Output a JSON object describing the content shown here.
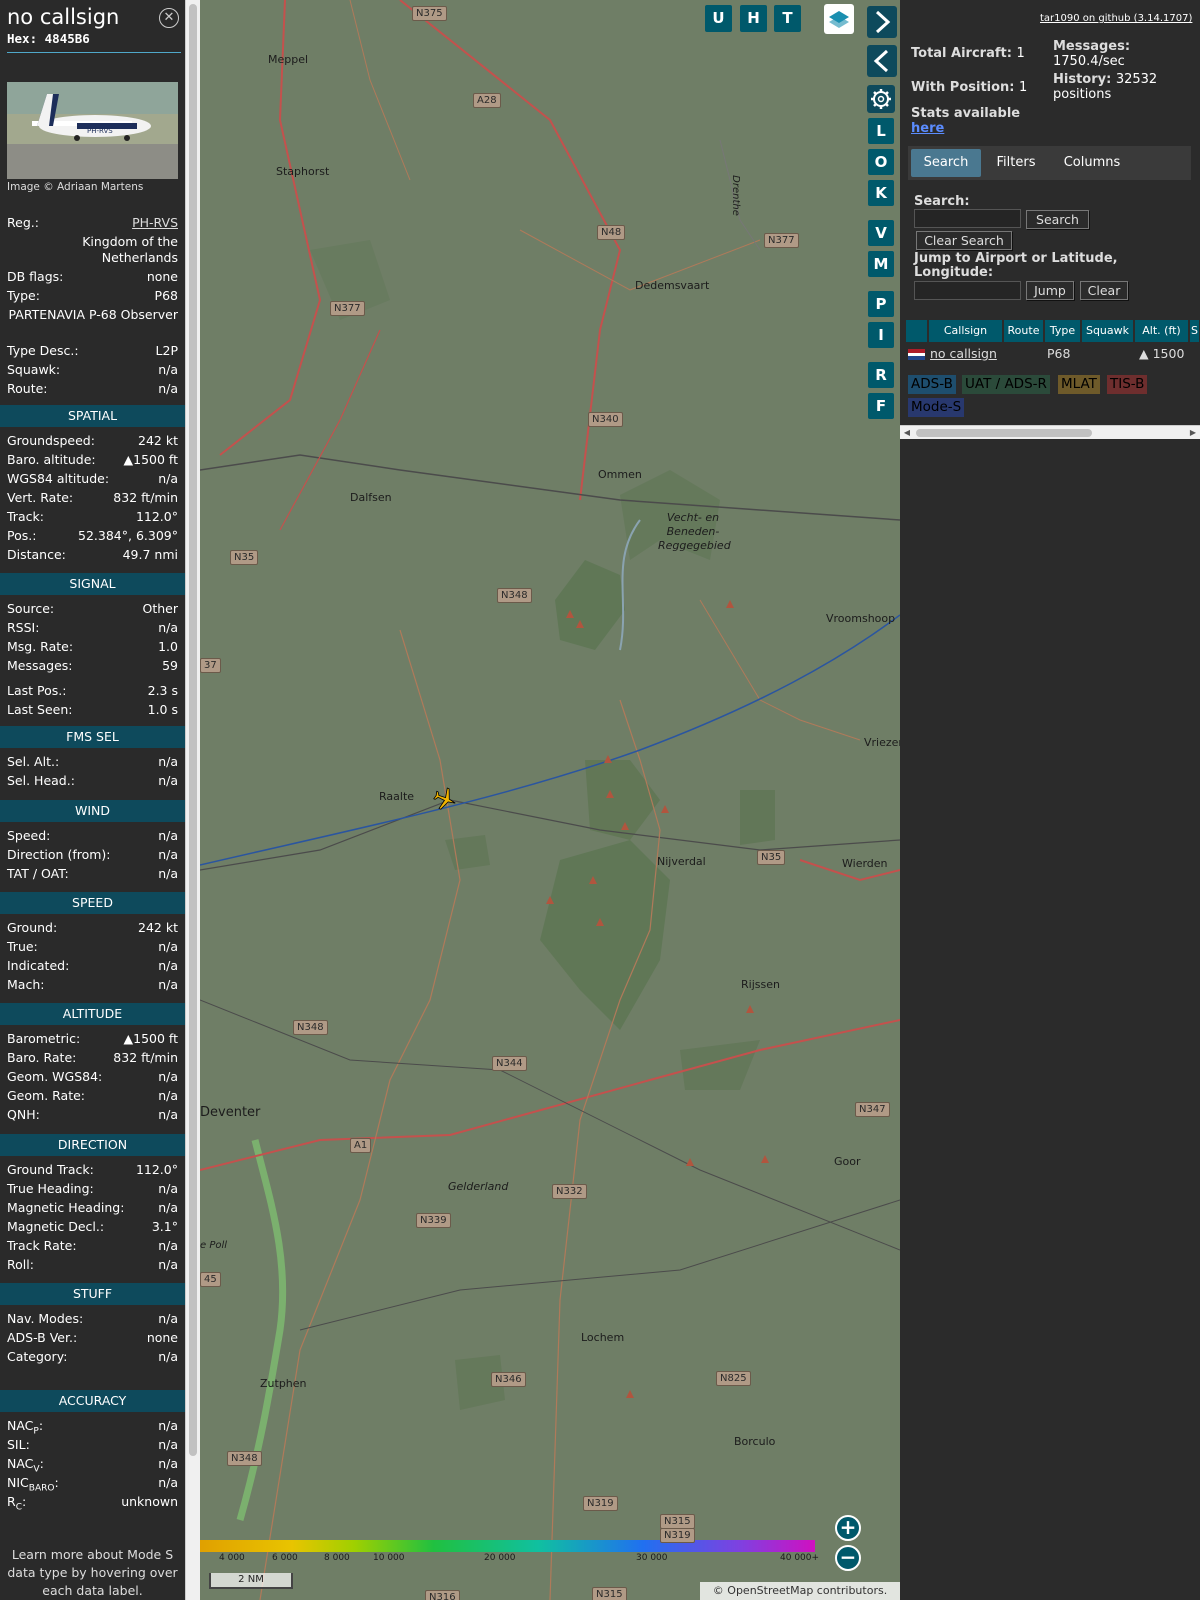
{
  "info": {
    "callsign": "no callsign",
    "hex_label": "Hex:",
    "hex": "4845B6",
    "photo_credit": "Image © Adriaan Martens",
    "photo_reg": "PH-RVS",
    "reg_label": "Reg.:",
    "reg": "PH-RVS",
    "country": "Kingdom of the Netherlands",
    "dbflags_label": "DB flags:",
    "dbflags": "none",
    "type_label": "Type:",
    "type": "P68",
    "type_full": "PARTENAVIA P-68 Observer",
    "typedesc_label": "Type Desc.:",
    "typedesc": "L2P",
    "squawk_label": "Squawk:",
    "squawk": "n/a",
    "route_label": "Route:",
    "route": "n/a",
    "sections": {
      "spatial": "SPATIAL",
      "signal": "SIGNAL",
      "fms": "FMS SEL",
      "wind": "WIND",
      "speed": "SPEED",
      "altitude": "ALTITUDE",
      "direction": "DIRECTION",
      "stuff": "STUFF",
      "accuracy": "ACCURACY"
    },
    "spatial": [
      {
        "k": "Groundspeed:",
        "v": "242 kt"
      },
      {
        "k": "Baro. altitude:",
        "v": "▲1500 ft"
      },
      {
        "k": "WGS84 altitude:",
        "v": "n/a"
      },
      {
        "k": "Vert. Rate:",
        "v": "832 ft/min"
      },
      {
        "k": "Track:",
        "v": "112.0°"
      },
      {
        "k": "Pos.:",
        "v": "52.384°, 6.309°"
      },
      {
        "k": "Distance:",
        "v": "49.7 nmi"
      }
    ],
    "signal": [
      {
        "k": "Source:",
        "v": "Other"
      },
      {
        "k": "RSSI:",
        "v": "n/a"
      },
      {
        "k": "Msg. Rate:",
        "v": "1.0"
      },
      {
        "k": "Messages:",
        "v": "59"
      },
      {
        "k": "Last Pos.:",
        "v": "2.3 s"
      },
      {
        "k": "Last Seen:",
        "v": "1.0 s"
      }
    ],
    "fms": [
      {
        "k": "Sel. Alt.:",
        "v": "n/a"
      },
      {
        "k": "Sel. Head.:",
        "v": "n/a"
      }
    ],
    "wind": [
      {
        "k": "Speed:",
        "v": "n/a"
      },
      {
        "k": "Direction (from):",
        "v": "n/a"
      },
      {
        "k": "TAT / OAT:",
        "v": "n/a"
      }
    ],
    "speed": [
      {
        "k": "Ground:",
        "v": "242 kt"
      },
      {
        "k": "True:",
        "v": "n/a"
      },
      {
        "k": "Indicated:",
        "v": "n/a"
      },
      {
        "k": "Mach:",
        "v": "n/a"
      }
    ],
    "altitude": [
      {
        "k": "Barometric:",
        "v": "▲1500 ft"
      },
      {
        "k": "Baro. Rate:",
        "v": "832 ft/min"
      },
      {
        "k": "Geom. WGS84:",
        "v": "n/a"
      },
      {
        "k": "Geom. Rate:",
        "v": "n/a"
      },
      {
        "k": "QNH:",
        "v": "n/a"
      }
    ],
    "direction": [
      {
        "k": "Ground Track:",
        "v": "112.0°"
      },
      {
        "k": "True Heading:",
        "v": "n/a"
      },
      {
        "k": "Magnetic Heading:",
        "v": "n/a"
      },
      {
        "k": "Magnetic Decl.:",
        "v": "3.1°"
      },
      {
        "k": "Track Rate:",
        "v": "n/a"
      },
      {
        "k": "Roll:",
        "v": "n/a"
      }
    ],
    "stuff": [
      {
        "k": "Nav. Modes:",
        "v": "n/a"
      },
      {
        "k": "ADS-B Ver.:",
        "v": "none"
      },
      {
        "k": "Category:",
        "v": "n/a"
      }
    ],
    "accuracy": [
      {
        "k": "NAC",
        "sub": "P",
        "v": "n/a"
      },
      {
        "k": "SIL:",
        "sub": "",
        "v": "n/a"
      },
      {
        "k": "NAC",
        "sub": "V",
        "v": "n/a"
      },
      {
        "k": "NIC",
        "sub": "BARO",
        "v": "n/a"
      },
      {
        "k": "R",
        "sub": "C",
        "v": "unknown"
      }
    ],
    "learn_more": "Learn more about Mode S data type by hovering over each data label."
  },
  "map": {
    "toolbar_top": [
      "U",
      "H",
      "T"
    ],
    "toolbar_side": [
      "L",
      "O",
      "K",
      "V",
      "M",
      "P",
      "I",
      "R",
      "F"
    ],
    "icons": {
      "layers": "layers-icon",
      "forward": "chevron-right-icon",
      "back": "chevron-left-icon",
      "expand": "expand-horizontal-icon",
      "settings": "gear-icon"
    },
    "towns": [
      "Meppel",
      "Staphorst",
      "Dedemsvaart",
      "Dalfsen",
      "Ommen",
      "Vroomshoop",
      "Raalte",
      "Nijverdal",
      "Wierden",
      "Vriezen",
      "Rijssen",
      "Deventer",
      "Goor",
      "Lochem",
      "Zutphen",
      "Borculo"
    ],
    "areas": [
      "Vecht- en Beneden-Reggegebied",
      "Gelderland",
      "Drenthe",
      "e Poll"
    ],
    "roads": [
      "N375",
      "A28",
      "N48",
      "N377",
      "N377",
      "N340",
      "N35",
      "N348",
      "N35",
      "N348",
      "N344",
      "A1",
      "N332",
      "N339",
      "N347",
      "N346",
      "N825",
      "N348",
      "N319",
      "N315",
      "N319",
      "N316",
      "N315",
      "37",
      "45"
    ],
    "altitude_scale": [
      "4 000",
      "6 000",
      "8 000",
      "10 000",
      "20 000",
      "30 000",
      "40 000+"
    ],
    "scalebar": "2 NM",
    "attribution_pre": "© ",
    "attribution_link": "OpenStreetMap",
    "attribution_post": " contributors.",
    "zoom_in": "+",
    "zoom_out": "−",
    "colors": {
      "land": "#6f7e66",
      "forest": "#5d7552",
      "track": "#2a55a0",
      "aircraft": "#f0b400"
    }
  },
  "right": {
    "github_link": "tar1090 on github (3.14.1707)",
    "total_aircraft_label": "Total Aircraft:",
    "total_aircraft": "1",
    "with_position_label": "With Position:",
    "with_position": "1",
    "messages_label": "Messages:",
    "messages": "1750.4/sec",
    "history_label": "History:",
    "history": "32532 positions",
    "stats_label": "Stats available",
    "stats_link": "here",
    "tabs": [
      "Search",
      "Filters",
      "Columns"
    ],
    "search_label": "Search:",
    "search_value": "",
    "search_button": "Search",
    "clear_search_button": "Clear Search",
    "jump_label": "Jump to Airport or Latitude, Longitude:",
    "jump_value": "",
    "jump_button": "Jump",
    "clear_button": "Clear",
    "table": {
      "headers": [
        "",
        "Callsign",
        "Route",
        "Type",
        "Squawk",
        "Alt. (ft)",
        "S"
      ],
      "rows": [
        {
          "callsign": "no callsign",
          "route": "",
          "type": "P68",
          "squawk": "",
          "alt": "▲ 1500"
        }
      ]
    },
    "sources": [
      "ADS-B",
      "UAT / ADS-R",
      "MLAT",
      "TIS-B",
      "Mode-S"
    ],
    "source_colors": [
      "#1e4e6e",
      "#2b4a3a",
      "#6e5a2a",
      "#6e2e2e",
      "#28386e"
    ]
  }
}
